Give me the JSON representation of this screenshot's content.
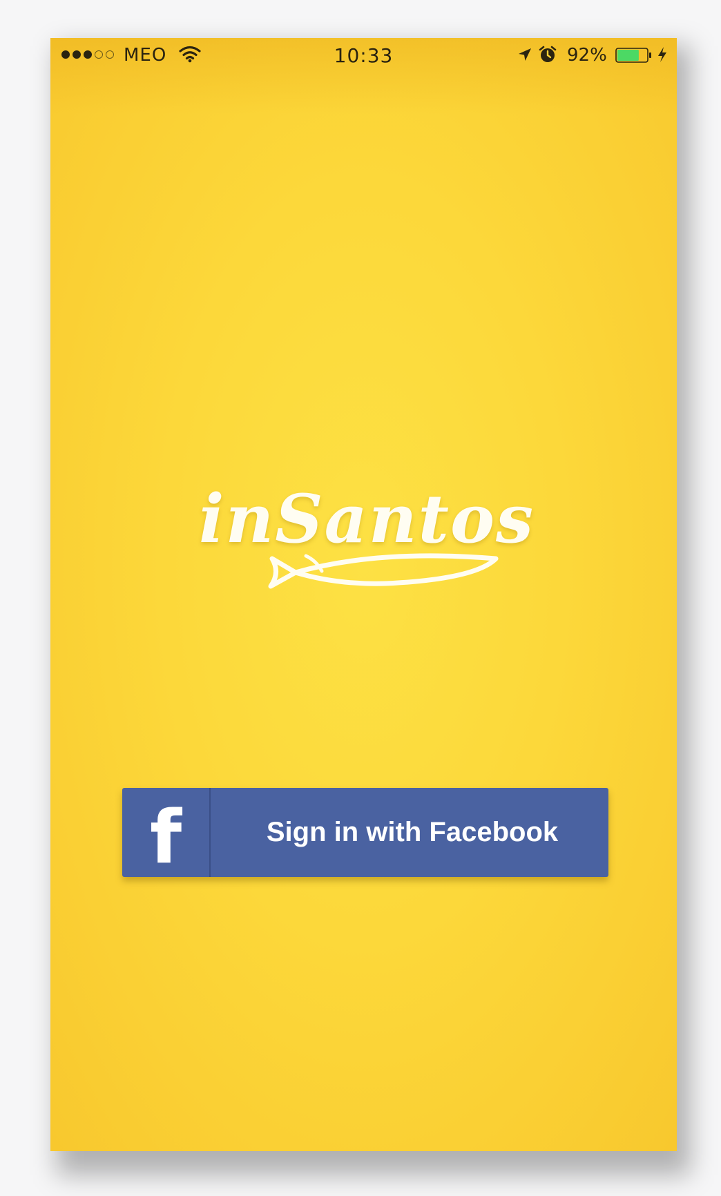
{
  "status_bar": {
    "signal_bars_filled": 3,
    "signal_bars_total": 5,
    "carrier": "MEO",
    "wifi_icon": "wifi-icon",
    "time": "10:33",
    "location_icon": "location-arrow-icon",
    "alarm_icon": "alarm-clock-icon",
    "battery_percent": "92%",
    "battery_level": 0.92,
    "charging_icon": "bolt-icon"
  },
  "logo": {
    "text": "inSantos",
    "icon": "sardine-fish-icon"
  },
  "login": {
    "facebook_icon": "facebook-f-icon",
    "facebook_glyph": "f",
    "facebook_button_label": "Sign in with Facebook"
  },
  "colors": {
    "background": "#fcd83a",
    "facebook_blue": "#4a62a1",
    "logo_white": "#fffdf2",
    "battery_green": "#4cd964"
  }
}
